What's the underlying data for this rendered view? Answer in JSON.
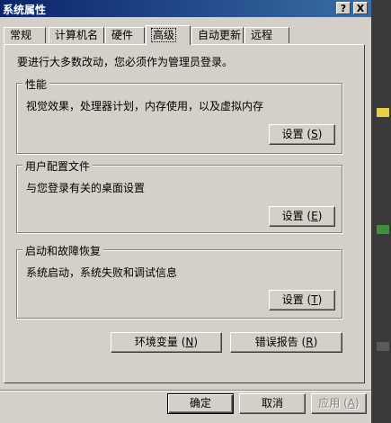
{
  "window": {
    "title": "系统属性",
    "help_btn": "?",
    "close_btn": "X"
  },
  "tabs": [
    {
      "label": "常规"
    },
    {
      "label": "计算机名"
    },
    {
      "label": "硬件"
    },
    {
      "label": "高级",
      "active": true
    },
    {
      "label": "自动更新"
    },
    {
      "label": "远程"
    }
  ],
  "notice": "要进行大多数改动，您必须作为管理员登录。",
  "groups": {
    "performance": {
      "legend": "性能",
      "desc": "视觉效果，处理器计划，内存使用，以及虚拟内存",
      "button": "设置",
      "accel": "S"
    },
    "profiles": {
      "legend": "用户配置文件",
      "desc": "与您登录有关的桌面设置",
      "button": "设置",
      "accel": "E"
    },
    "startup": {
      "legend": "启动和故障恢复",
      "desc": "系统启动，系统失败和调试信息",
      "button": "设置",
      "accel": "T"
    }
  },
  "env_button": {
    "label": "环境变量",
    "accel": "N"
  },
  "error_button": {
    "label": "错误报告",
    "accel": "R"
  },
  "footer": {
    "ok": "确定",
    "cancel": "取消",
    "apply": {
      "label": "应用",
      "accel": "A"
    }
  },
  "colors": {
    "face": "#d4d0c8",
    "title_start": "#0a246a",
    "title_end": "#3a6ea5"
  }
}
